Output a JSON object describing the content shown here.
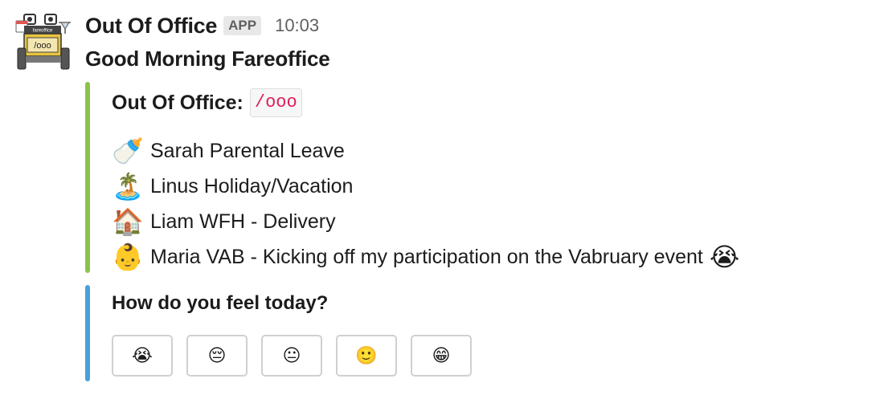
{
  "message": {
    "sender": "Out Of Office",
    "badge": "APP",
    "time": "10:03",
    "greeting": "Good Morning Fareoffice"
  },
  "avatar": {
    "top_text": "fareoffice",
    "screen_text": "/ooo"
  },
  "ooo_attachment": {
    "title": "Out Of Office:",
    "command": "/ooo",
    "accent_color": "#8bc34a",
    "entries": [
      {
        "emoji": "🍼",
        "icon": "baby-bottle-icon",
        "text": "Sarah Parental Leave"
      },
      {
        "emoji": "🏝️",
        "icon": "island-icon",
        "text": "Linus Holiday/Vacation"
      },
      {
        "emoji": "🏠",
        "icon": "house-icon",
        "text": "Liam WFH - Delivery"
      },
      {
        "emoji": "👶",
        "icon": "baby-icon",
        "text": "Maria VAB - Kicking off my participation on the Vabruary event",
        "extra_emoji": "😭"
      }
    ]
  },
  "feel_attachment": {
    "question": "How do you feel today?",
    "accent_color": "#4a9fd8",
    "buttons": [
      {
        "emoji": "😭",
        "icon": "crying-face-icon"
      },
      {
        "emoji": "😔",
        "icon": "pensive-face-icon"
      },
      {
        "emoji": "😐",
        "icon": "neutral-face-icon"
      },
      {
        "emoji": "🙂",
        "icon": "slightly-smiling-face-icon"
      },
      {
        "emoji": "😁",
        "icon": "grinning-face-icon"
      }
    ]
  }
}
